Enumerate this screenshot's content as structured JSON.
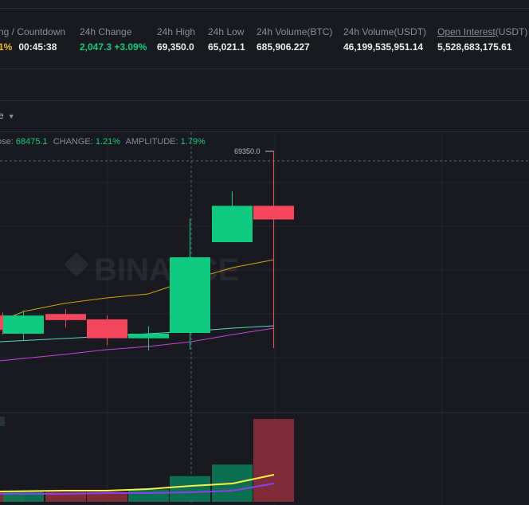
{
  "stats": [
    {
      "label": "ng / Countdown",
      "value": "00:45:38",
      "prefix": "1%",
      "id": "countdown"
    },
    {
      "label": "24h Change",
      "value": "2,047.3 +3.09%",
      "id": "change"
    },
    {
      "label": "24h High",
      "value": "69,350.0",
      "id": "high"
    },
    {
      "label": "24h Low",
      "value": "65,021.1",
      "id": "low"
    },
    {
      "label": "24h Volume(BTC)",
      "value": "685,906.227",
      "id": "vol-btc"
    },
    {
      "label": "24h Volume(USDT)",
      "value": "46,199,535,951.14",
      "id": "vol-usdt"
    },
    {
      "label": "Open Interest",
      "label_suffix": "(USDT)",
      "value": "5,528,683,175.61",
      "id": "open-interest"
    }
  ],
  "toolbar": {
    "interval_label": "e"
  },
  "ohlc": {
    "close_label": "ose:",
    "close_value": "68475.1",
    "change_label": "CHANGE:",
    "change_value": "1.21%",
    "amplitude_label": "AMPLITUDE:",
    "amplitude_value": "1.79%"
  },
  "price_marker": "69350.0",
  "watermark": "BINANCE",
  "colors": {
    "up": "#0ecb81",
    "down": "#f6465d",
    "ma_orange": "#f0b90b",
    "ma_teal": "#5fd3c0",
    "ma_purple": "#c047d6",
    "vol_ma_yellow": "#f8f04a",
    "vol_ma_purple": "#8a3ff0"
  },
  "chart_data": {
    "type": "candlestick",
    "candles": [
      {
        "open": 67180,
        "close": 66990,
        "high": 67220,
        "low": 66930,
        "dir": "down",
        "partial": true
      },
      {
        "open": 66940,
        "close": 67180,
        "high": 67250,
        "low": 66850,
        "dir": "up"
      },
      {
        "open": 67200,
        "close": 67120,
        "high": 67270,
        "low": 67020,
        "dir": "down"
      },
      {
        "open": 67130,
        "close": 66880,
        "high": 67180,
        "low": 66790,
        "dir": "down"
      },
      {
        "open": 66880,
        "close": 66940,
        "high": 67040,
        "low": 66720,
        "dir": "up"
      },
      {
        "open": 66950,
        "close": 67950,
        "high": 68460,
        "low": 66730,
        "dir": "up"
      },
      {
        "open": 68150,
        "close": 68630,
        "high": 68820,
        "low": 68350,
        "dir": "up"
      },
      {
        "open": 68630,
        "close": 68450,
        "high": 69350,
        "low": 66750,
        "dir": "down"
      }
    ],
    "volumes": [
      {
        "value": 0.12,
        "dir": "down"
      },
      {
        "value": 0.12,
        "dir": "up"
      },
      {
        "value": 0.12,
        "dir": "down"
      },
      {
        "value": 0.12,
        "dir": "down"
      },
      {
        "value": 0.15,
        "dir": "up"
      },
      {
        "value": 0.31,
        "dir": "up"
      },
      {
        "value": 0.45,
        "dir": "up"
      },
      {
        "value": 1.0,
        "dir": "down"
      }
    ]
  }
}
